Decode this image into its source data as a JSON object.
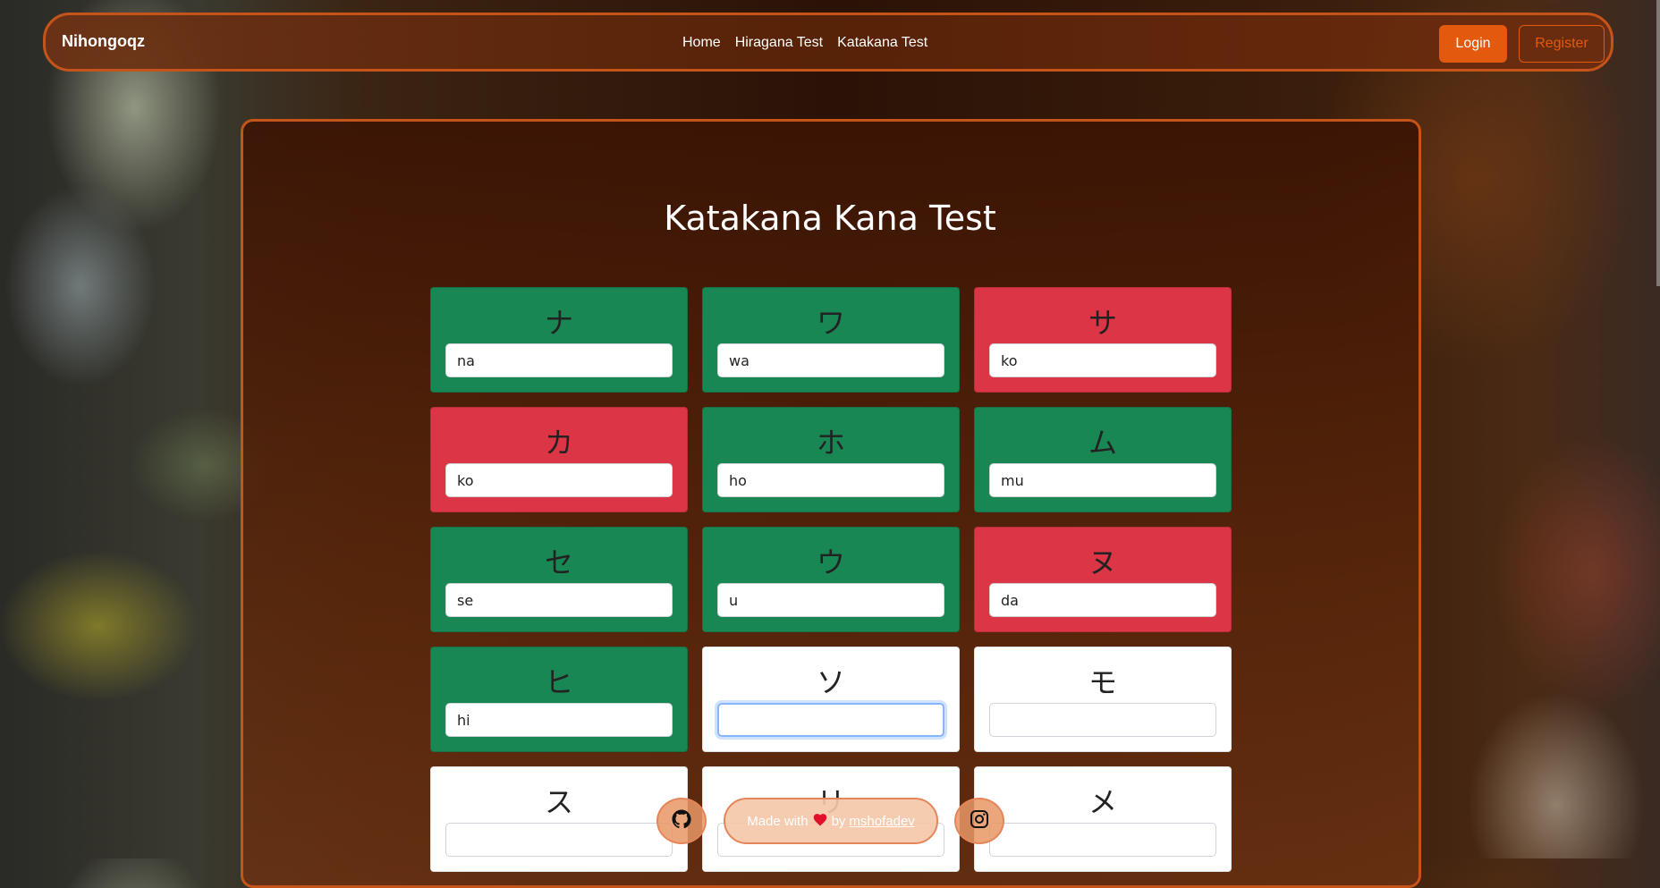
{
  "navbar": {
    "brand": "Nihongoqz",
    "links": [
      "Home",
      "Hiragana Test",
      "Katakana Test"
    ],
    "login": "Login",
    "register": "Register"
  },
  "page": {
    "title": "Katakana Kana Test"
  },
  "cards": [
    {
      "kana": "ナ",
      "answer": "na",
      "status": "correct"
    },
    {
      "kana": "ワ",
      "answer": "wa",
      "status": "correct"
    },
    {
      "kana": "サ",
      "answer": "ko",
      "status": "wrong"
    },
    {
      "kana": "カ",
      "answer": "ko",
      "status": "wrong"
    },
    {
      "kana": "ホ",
      "answer": "ho",
      "status": "correct"
    },
    {
      "kana": "ム",
      "answer": "mu",
      "status": "correct"
    },
    {
      "kana": "セ",
      "answer": "se",
      "status": "correct"
    },
    {
      "kana": "ウ",
      "answer": "u",
      "status": "correct"
    },
    {
      "kana": "ヌ",
      "answer": "da",
      "status": "wrong"
    },
    {
      "kana": "ヒ",
      "answer": "hi",
      "status": "correct"
    },
    {
      "kana": "ソ",
      "answer": "",
      "status": "blank",
      "focused": true
    },
    {
      "kana": "モ",
      "answer": "",
      "status": "blank"
    },
    {
      "kana": "ス",
      "answer": "",
      "status": "blank"
    },
    {
      "kana": "リ",
      "answer": "",
      "status": "blank"
    },
    {
      "kana": "メ",
      "answer": "",
      "status": "blank"
    }
  ],
  "footer": {
    "made_with": "Made with",
    "by": "by",
    "author": "mshofadev",
    "heart_icon": "heart-icon",
    "github_icon": "github-icon",
    "instagram_icon": "instagram-icon"
  },
  "colors": {
    "accent": "#e35a0e",
    "correct": "#198754",
    "wrong": "#dc3545",
    "blank": "#ffffff"
  }
}
